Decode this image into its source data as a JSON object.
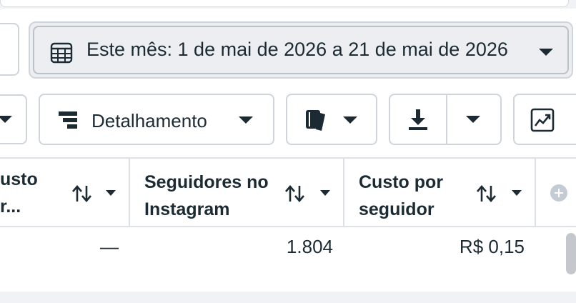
{
  "toolbar": {
    "date_range_label": "Este mês: 1 de mai de 2026 a 21 de mai de 2026",
    "breakdown_label": "Detalhamento"
  },
  "table": {
    "columns": [
      {
        "label": "usto\nr..."
      },
      {
        "label": "Seguidores no\nInstagram"
      },
      {
        "label": "Custo por\nseguidor"
      }
    ],
    "row": {
      "col1": "—",
      "col2": "1.804",
      "col3": "R$ 0,15"
    }
  },
  "icons": {
    "calendar": "calendar-icon",
    "breakdown": "breakdown-icon",
    "reports": "reports-icon",
    "export": "download-icon",
    "chart": "chart-icon",
    "sort": "sort-icon",
    "add_column": "add-column-icon"
  },
  "colors": {
    "text": "#1c2b33",
    "border": "#cfd5db",
    "background": "#f0f2f5"
  }
}
